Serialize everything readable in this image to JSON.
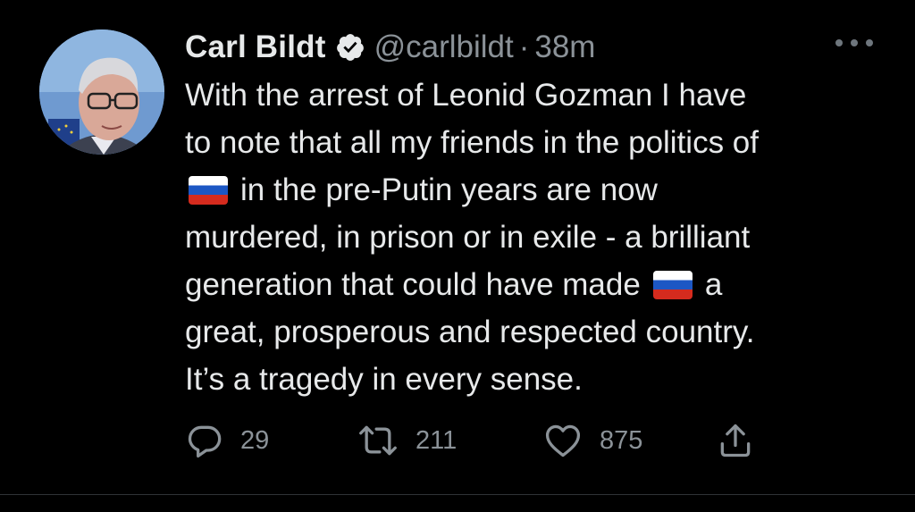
{
  "tweet": {
    "author": {
      "name": "Carl Bildt",
      "handle": "@carlbildt",
      "verified": true
    },
    "separator": "·",
    "time": "38m",
    "body": {
      "line1": "With the arrest of Leonid Gozman I have",
      "line2": "to note that all my friends in the politics of",
      "line3_after_flag": "in the pre-Putin years are now",
      "line4": "murdered, in prison or in exile  - a brilliant",
      "line5_before_flag": "generation that could have made",
      "line5_after_flag": "a",
      "line6": "great, prosperous and respected country.",
      "line7": "It’s a tragedy in every sense."
    },
    "flag_emoji": "russia-flag-icon",
    "actions": {
      "replies": "29",
      "retweets": "211",
      "likes": "875"
    }
  },
  "colors": {
    "background": "#000000",
    "text_primary": "#e7e9ea",
    "text_secondary": "#8b9298",
    "verified_badge": "#e7e9ea"
  }
}
